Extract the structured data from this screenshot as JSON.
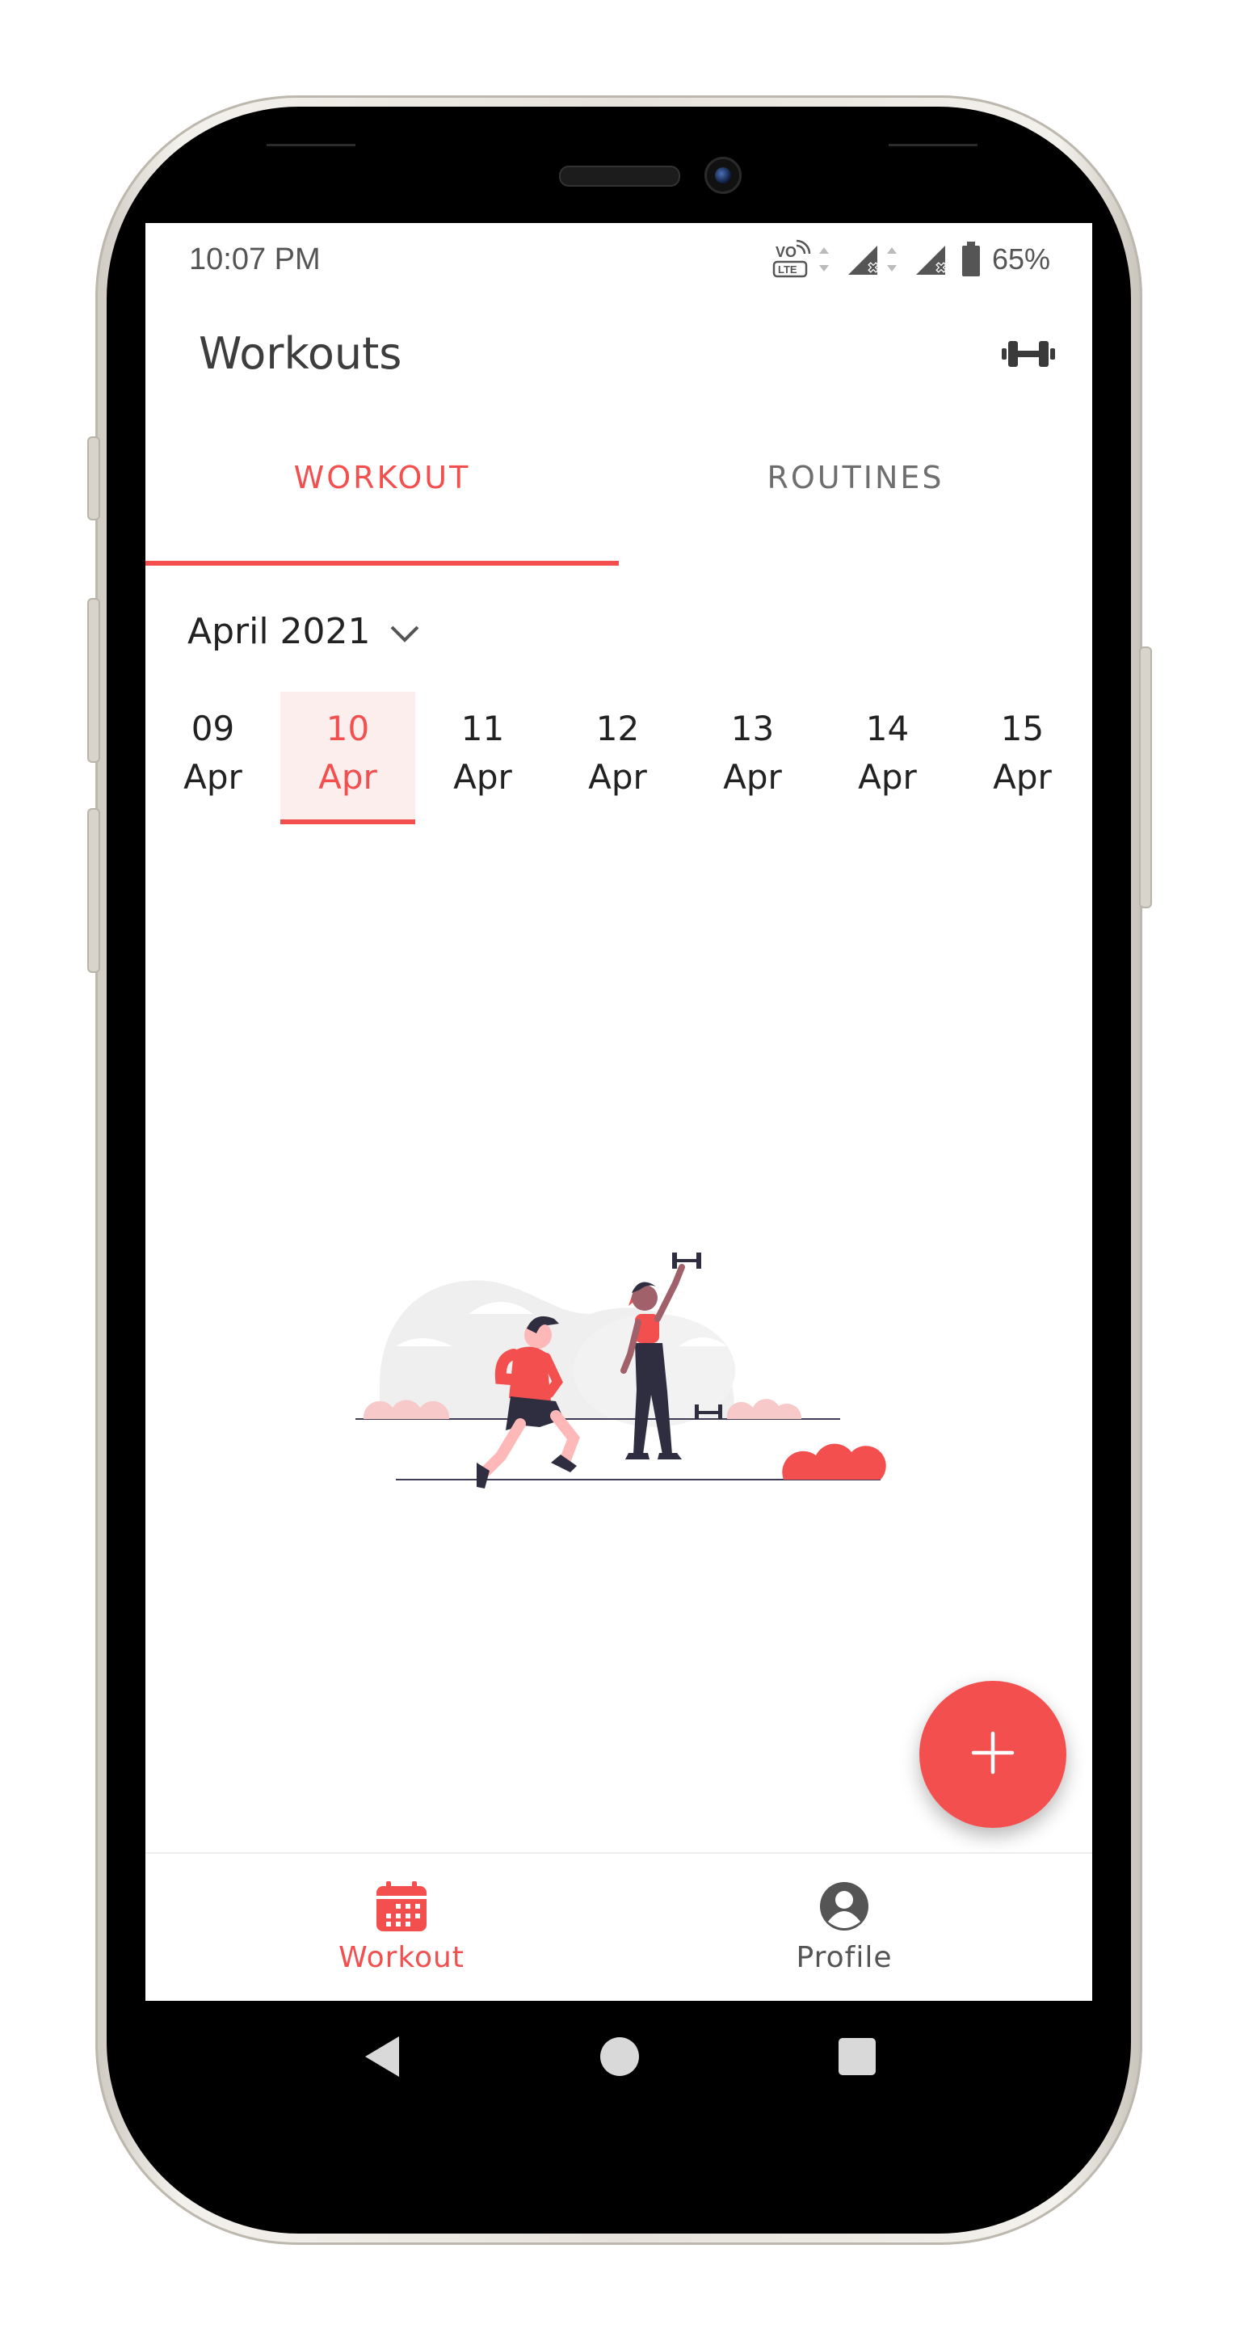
{
  "status_bar": {
    "time": "10:07 PM",
    "battery": "65%",
    "icons": [
      "volte-icon",
      "signal-no-data-icon",
      "signal-no-data-icon",
      "battery-icon"
    ]
  },
  "app_bar": {
    "title": "Workouts",
    "action_icon": "dumbbell-icon"
  },
  "tabs": [
    {
      "label": "WORKOUT",
      "active": true
    },
    {
      "label": "ROUTINES",
      "active": false
    }
  ],
  "month_picker": {
    "label": "April 2021",
    "icon": "chevron-down-icon"
  },
  "dates": [
    {
      "day": "09",
      "month": "Apr",
      "selected": false
    },
    {
      "day": "10",
      "month": "Apr",
      "selected": true
    },
    {
      "day": "11",
      "month": "Apr",
      "selected": false
    },
    {
      "day": "12",
      "month": "Apr",
      "selected": false
    },
    {
      "day": "13",
      "month": "Apr",
      "selected": false
    },
    {
      "day": "14",
      "month": "Apr",
      "selected": false
    },
    {
      "day": "15",
      "month": "Apr",
      "selected": false
    }
  ],
  "fab": {
    "icon": "plus-icon"
  },
  "bottom_nav": [
    {
      "label": "Workout",
      "icon": "calendar-icon",
      "active": true
    },
    {
      "label": "Profile",
      "icon": "account-circle-icon",
      "active": false
    }
  ],
  "colors": {
    "accent": "#f44f4f",
    "selected_date_bg": "#fdeeee",
    "text_dark": "#222222",
    "text_muted": "#6e6e6e"
  }
}
